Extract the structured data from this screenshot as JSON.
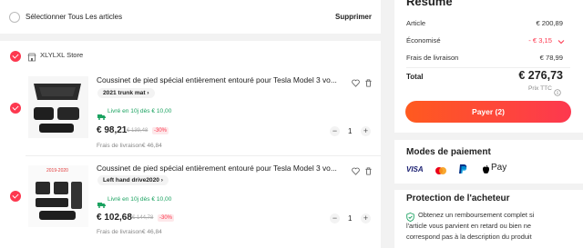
{
  "top_bar": {
    "select_all": "Sélectionner Tous Les articles",
    "delete": "Supprimer"
  },
  "store": {
    "name": "XLYLXL Store"
  },
  "items": [
    {
      "title": "Coussinet de pied spécial entièrement entouré pour Tesla Model 3 vo...",
      "variant": "2021 trunk mat",
      "shipping": "Livré en 10j dès € 10,00",
      "price": "€ 98,21",
      "old_price": "€ 139,48",
      "discount": "-30%",
      "fee": "Frais de livraison€ 46,84",
      "qty": "1"
    },
    {
      "title": "Coussinet de pied spécial entièrement entouré pour Tesla Model 3 vo...",
      "variant": "Left hand drive2020",
      "shipping": "Livré en 10j dès € 10,00",
      "price": "€ 102,68",
      "old_price": "€ 144,78",
      "discount": "-30%",
      "fee": "Frais de livraison€ 46,84",
      "qty": "1",
      "image_caption": "2019-2020"
    }
  ],
  "summary": {
    "heading": "Résumé",
    "article_label": "Article",
    "article_value": "€ 200,89",
    "savings_label": "Économisé",
    "savings_value": "- € 3,15",
    "shipping_label": "Frais de livraison",
    "shipping_value": "€ 78,99",
    "total_label": "Total",
    "total_value": "€ 276,73",
    "tax_note": "Prix TTC",
    "pay_button": "Payer (2)"
  },
  "payment": {
    "heading": "Modes de paiement",
    "visa": "VISA",
    "applepay": "Pay"
  },
  "protection": {
    "heading": "Protection de l'acheteur",
    "text_1": "Obtenez un remboursement complet si",
    "text_2": "l'article vous parvient en retard ou bien ne",
    "text_3": "correspond pas à la description du produit"
  },
  "colors": {
    "accent": "#fd384f",
    "pay_gradient_start": "#ff5a1f",
    "pay_gradient_end": "#fd384f",
    "shipping_green": "#1aa260"
  }
}
